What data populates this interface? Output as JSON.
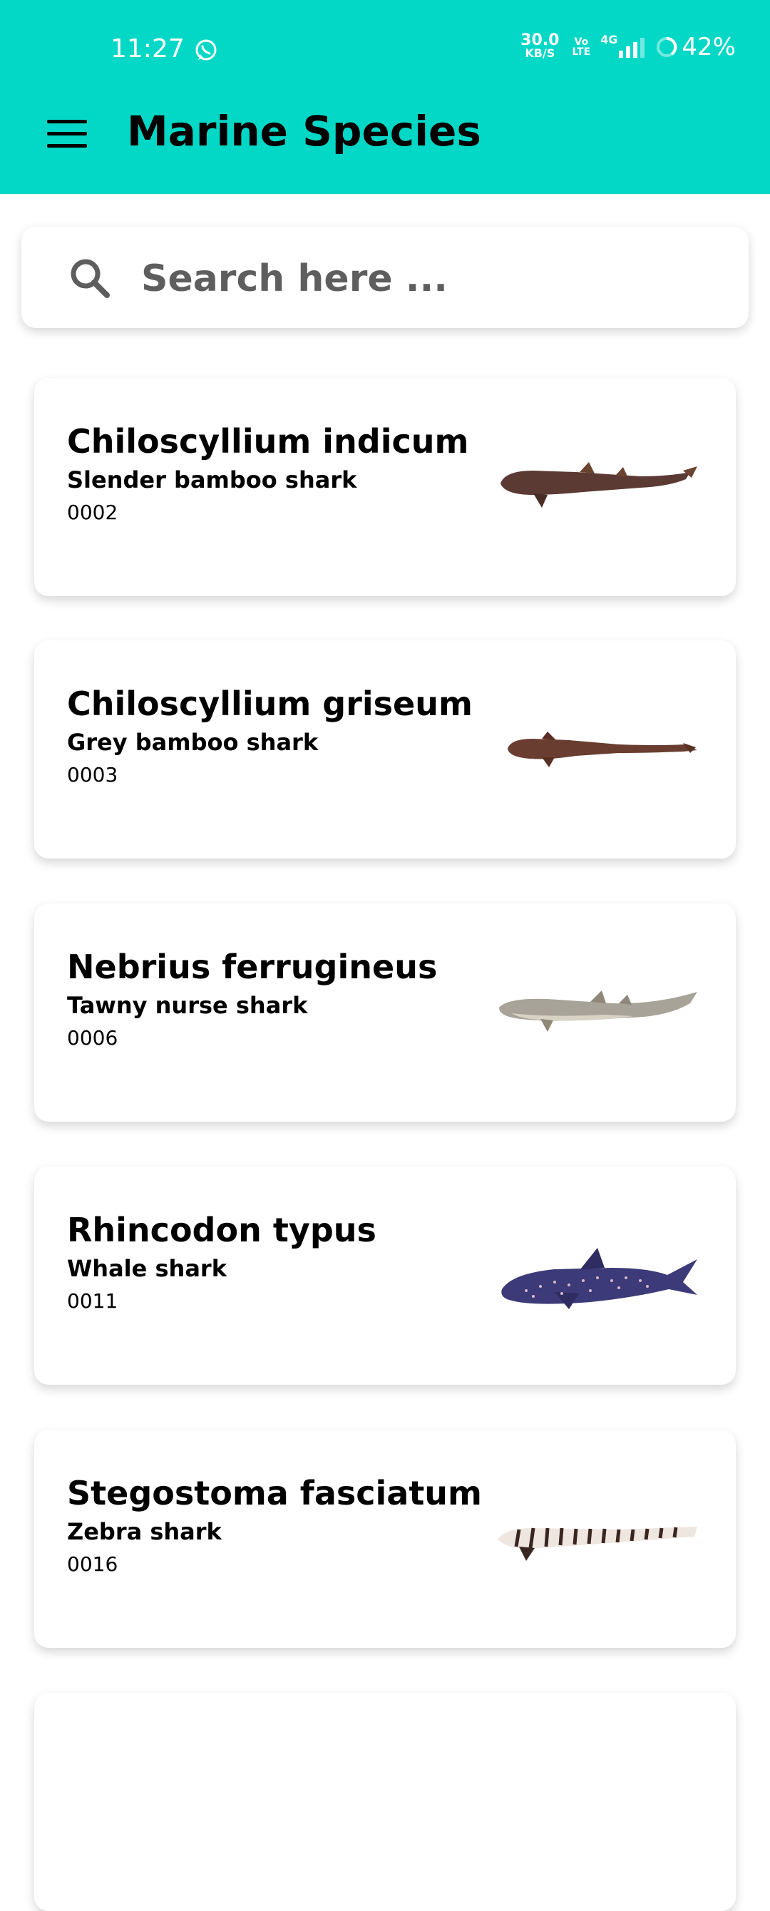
{
  "status_bar": {
    "time": "11:27",
    "speed_value": "30.0",
    "speed_unit": "KB/S",
    "volte_top": "Vo",
    "volte_bottom": "LTE",
    "network": "4G",
    "battery": "42%"
  },
  "app_bar": {
    "title": "Marine Species",
    "background_color": "#03d7c6"
  },
  "search": {
    "placeholder": "Search here ..."
  },
  "species": [
    {
      "scientific": "Chiloscyllium indicum",
      "common": "Slender bamboo shark",
      "code": "0002",
      "image": "slender-bamboo-shark"
    },
    {
      "scientific": "Chiloscyllium griseum",
      "common": "Grey bamboo shark",
      "code": "0003",
      "image": "grey-bamboo-shark"
    },
    {
      "scientific": "Nebrius ferrugineus",
      "common": "Tawny nurse shark",
      "code": "0006",
      "image": "tawny-nurse-shark"
    },
    {
      "scientific": "Rhincodon typus",
      "common": "Whale shark",
      "code": "0011",
      "image": "whale-shark"
    },
    {
      "scientific": "Stegostoma fasciatum",
      "common": "Zebra shark",
      "code": "0016",
      "image": "zebra-shark"
    }
  ]
}
